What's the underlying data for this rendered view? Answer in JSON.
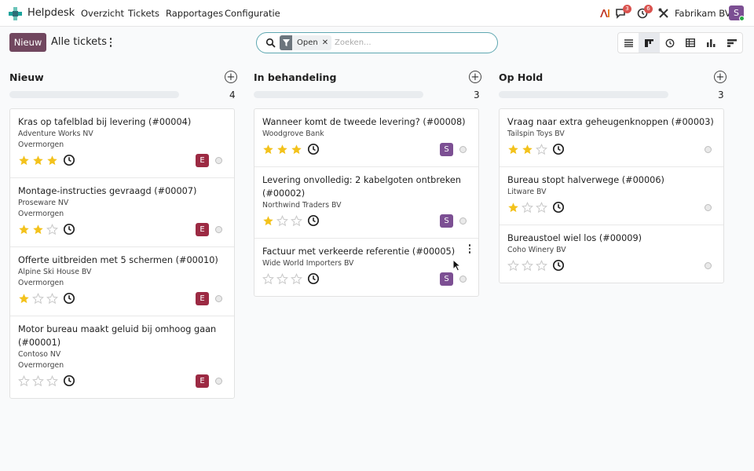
{
  "app": {
    "name": "Helpdesk"
  },
  "menu": [
    "Overzicht",
    "Tickets",
    "Rapportages",
    "Configuratie"
  ],
  "systray": {
    "messages_count": "3",
    "activities_count": "6",
    "company": "Fabrikam BV",
    "user_initial": "S"
  },
  "control": {
    "new_label": "Nieuw",
    "breadcrumb": "Alle tickets",
    "filter_facet": "Open",
    "search_placeholder": "Zoeken..."
  },
  "columns": [
    {
      "title": "Nieuw",
      "count": "4",
      "cards": [
        {
          "title": "Kras op tafelblad bij levering (#00004)",
          "company": "Adventure Works NV",
          "stage": "Overmorgen",
          "rating": 3,
          "avatar": "E"
        },
        {
          "title": "Montage-instructies gevraagd (#00007)",
          "company": "Proseware NV",
          "stage": "Overmorgen",
          "rating": 2,
          "avatar": "E"
        },
        {
          "title": "Offerte uitbreiden met 5 schermen (#00010)",
          "company": "Alpine Ski House BV",
          "stage": "Overmorgen",
          "rating": 1,
          "avatar": "E"
        },
        {
          "title": "Motor bureau maakt geluid bij omhoog gaan (#00001)",
          "company": "Contoso NV",
          "stage": "Overmorgen",
          "rating": 0,
          "avatar": "E"
        }
      ]
    },
    {
      "title": "In behandeling",
      "count": "3",
      "cards": [
        {
          "title": "Wanneer komt de tweede levering? (#00008)",
          "company": "Woodgrove Bank",
          "rating": 3,
          "avatar": "S"
        },
        {
          "title": "Levering onvolledig: 2 kabelgoten ontbreken (#00002)",
          "company": "Northwind Traders BV",
          "rating": 1,
          "avatar": "S"
        },
        {
          "title": "Factuur met verkeerde referentie (#00005)",
          "company": "Wide World Importers BV",
          "rating": 0,
          "avatar": "S"
        }
      ]
    },
    {
      "title": "Op Hold",
      "count": "3",
      "cards": [
        {
          "title": "Vraag naar extra geheugenknoppen (#00003)",
          "company": "Tailspin Toys BV",
          "rating": 2
        },
        {
          "title": "Bureau stopt halverwege (#00006)",
          "company": "Litware BV",
          "rating": 1
        },
        {
          "title": "Bureaustoel wiel los (#00009)",
          "company": "Coho Winery BV",
          "rating": 0
        }
      ]
    }
  ],
  "colors": {
    "primary": "#71475f",
    "avatar_e": "#9c2a43",
    "avatar_s": "#7c4f93",
    "star_on": "#f3c21c",
    "star_off": "#c8c8c8",
    "search_border": "#5ea7b1"
  },
  "icons": [
    "helpdesk-logo-icon",
    "search-icon",
    "filter-icon",
    "close-icon",
    "list-view-icon",
    "kanban-view-icon",
    "activity-view-icon",
    "pivot-view-icon",
    "graph-view-icon",
    "cohort-view-icon",
    "plus-icon",
    "star-icon",
    "clock-icon"
  ]
}
